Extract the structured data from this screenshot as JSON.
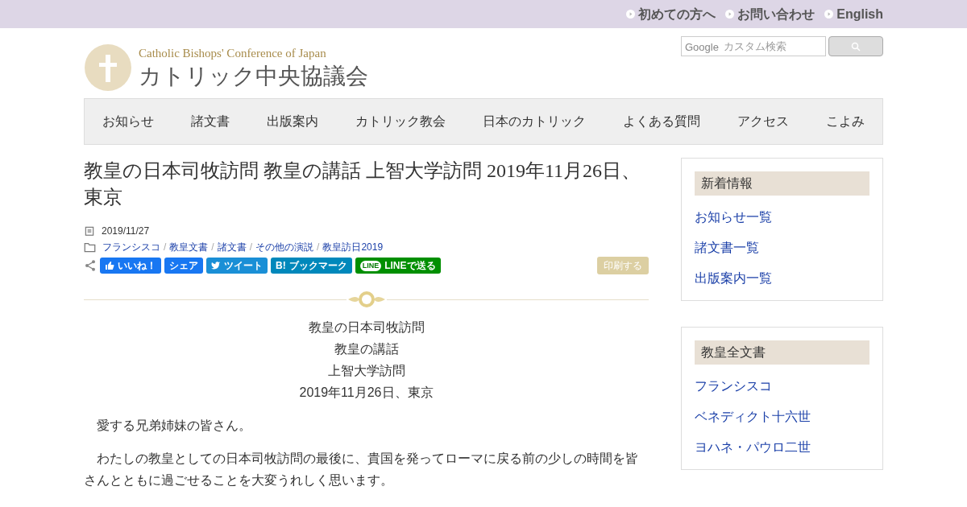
{
  "top_links": [
    "初めての方へ",
    "お問い合わせ",
    "English"
  ],
  "logo": {
    "subtitle": "Catholic Bishops' Conference of Japan",
    "title": "カトリック中央協議会"
  },
  "search": {
    "brand": "Google",
    "placeholder": "カスタム検索"
  },
  "nav": [
    "お知らせ",
    "諸文書",
    "出版案内",
    "カトリック教会",
    "日本のカトリック",
    "よくある質問",
    "アクセス",
    "こよみ"
  ],
  "article": {
    "title": "教皇の日本司牧訪問 教皇の講話 上智大学訪問 2019年11月26日、東京",
    "date": "2019/11/27",
    "categories": [
      "フランシスコ",
      "教皇文書",
      "諸文書",
      "その他の演説",
      "教皇訪日2019"
    ],
    "category_separator": "/",
    "share_buttons": [
      {
        "kind": "like",
        "label": "いいね！"
      },
      {
        "kind": "share",
        "label": "シェア"
      },
      {
        "kind": "tweet",
        "label": "ツイート"
      },
      {
        "kind": "bookmark",
        "label": "ブックマーク",
        "prefix": "B!"
      },
      {
        "kind": "line",
        "label": "LINEで送る",
        "icon_text": "LINE"
      }
    ],
    "print_button": "印刷する",
    "heading_lines": [
      "教皇の日本司牧訪問",
      "教皇の講話",
      "上智大学訪問",
      "2019年11月26日、東京"
    ],
    "paragraphs": [
      "愛する兄弟姉妹の皆さん。",
      "わたしの教皇としての日本司牧訪問の最後に、貴国を発ってローマに戻る前の少しの時間を皆さんとともに過ごせることを大変うれしく思います。"
    ]
  },
  "sidebar": [
    {
      "heading": "新着情報",
      "links": [
        "お知らせ一覧",
        "諸文書一覧",
        "出版案内一覧"
      ]
    },
    {
      "heading": "教皇全文書",
      "links": [
        "フランシスコ",
        "ベネディクト十六世",
        "ヨハネ・パウロ二世"
      ]
    }
  ]
}
